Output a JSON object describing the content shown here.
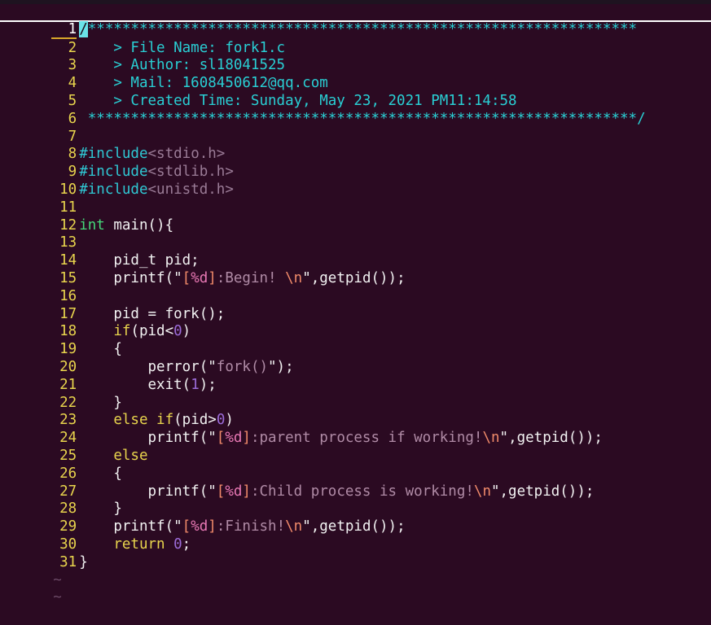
{
  "app": {
    "name": "vim",
    "mode": "normal",
    "background_color": "#2b0a22",
    "line_number_color": "#e8d44d",
    "cursor_color": "#6ae3e8",
    "cursorline_underline_color": "#ffffff"
  },
  "file": {
    "name": "fork1.c",
    "language": "c"
  },
  "cursor": {
    "line": 1,
    "column": 1,
    "char": "/"
  },
  "gutter": {
    "numbers": [
      "1",
      "2",
      "3",
      "4",
      "5",
      "6",
      "7",
      "8",
      "9",
      "10",
      "11",
      "12",
      "13",
      "14",
      "15",
      "16",
      "17",
      "18",
      "19",
      "20",
      "21",
      "22",
      "23",
      "24",
      "25",
      "26",
      "27",
      "28",
      "29",
      "30",
      "31"
    ]
  },
  "header_comment": {
    "rule": "/*****************************************************************",
    "asterisks_top": "****************************************************************",
    "file_name_line": "    > File Name: fork1.c",
    "author_line": "    > Author: sl18041525",
    "mail_line": "    > Mail: 1608450612@qq.com",
    "created_time_line": "    > Created Time: Sunday, May 23, 2021 PM11:14:58",
    "close_rule": " ****************************************************************/",
    "fields": {
      "file_name_label": "> File Name:",
      "file_name_value": "fork1.c",
      "author_label": "> Author:",
      "author_value": "sl18041525",
      "mail_label": "> Mail:",
      "mail_value": "1608450612@qq.com",
      "created_label": "> Created Time:",
      "created_value": "Sunday, May 23, 2021 PM11:14:58"
    }
  },
  "code": {
    "line1_slash": "/",
    "line1_stars": "****************************************************************",
    "line6_stars": " ****************************************************************",
    "line6_end": "/",
    "include_kw": "#include",
    "include_stdio": "<stdio.h>",
    "include_stdlib": "<stdlib.h>",
    "include_unistd": "<unistd.h>",
    "int_kw": "int",
    "main_sig": " main(){",
    "pid_decl": "    pid_t pid;",
    "printf_begin_pre": "    printf(\"",
    "printf_begin_bracket_open": "[",
    "printf_fmt": "%d",
    "printf_begin_bracket_close": "]",
    "printf_begin_body": ":Begin! ",
    "printf_escape": "\\n",
    "printf_begin_post": "\",getpid());",
    "assign_fork": "    pid = fork();",
    "if_kw": "    if",
    "if_cond_open": "(pid<",
    "zero": "0",
    "paren_close": ")",
    "brace_open": "    {",
    "brace_close": "    }",
    "perror_pre": "        perror(\"",
    "perror_body": "fork()",
    "perror_post": "\");",
    "exit_pre": "        exit(",
    "one": "1",
    "exit_post": ");",
    "else_if_kw": "    else if",
    "else_if_cond": "(pid>",
    "printf_parent_pre": "        printf(\"",
    "printf_parent_body": ":parent process if working!",
    "printf_parent_post": "\",getpid());",
    "else_kw": "    else",
    "printf_child_pre": "        printf(\"",
    "printf_child_body": ":Child process is working!",
    "printf_child_post": "\",getpid());",
    "printf_finish_pre": "    printf(\"",
    "printf_finish_body": ":Finish!",
    "printf_finish_post": "\",getpid());",
    "return_kw": "    return ",
    "return_val": "0",
    "semicolon": ";",
    "closing_brace": "}"
  },
  "eof_markers": [
    "~",
    "~"
  ]
}
